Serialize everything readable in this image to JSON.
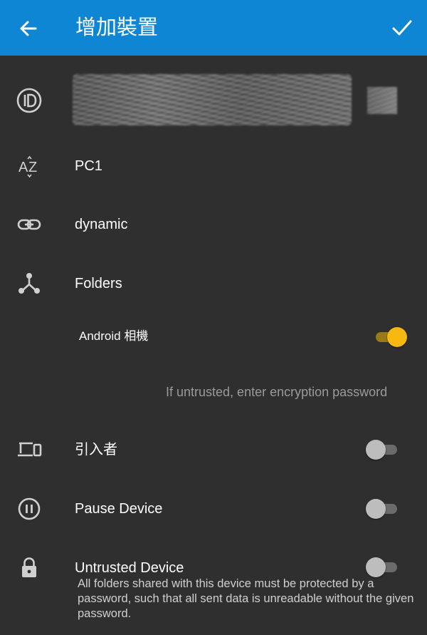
{
  "app_bar": {
    "title": "增加裝置",
    "back_icon": "arrow-left-icon",
    "done_icon": "check-icon"
  },
  "rows": {
    "device_id": {
      "icon": "id-icon",
      "value_state": "redacted (blurred)"
    },
    "name": {
      "icon": "sort-az-icon",
      "value": "PC1"
    },
    "address": {
      "icon": "link-icon",
      "value": "dynamic"
    },
    "folders": {
      "icon": "share-nodes-icon",
      "label": "Folders"
    },
    "folder_item": {
      "label": "Android 相機",
      "enabled": true
    },
    "encryption_hint": "If untrusted, enter encryption password",
    "introducer": {
      "icon": "devices-icon",
      "label": "引入者",
      "enabled": false
    },
    "pause": {
      "icon": "pause-circle-icon",
      "label": "Pause Device",
      "enabled": false
    },
    "untrusted": {
      "icon": "lock-icon",
      "label": "Untrusted Device",
      "description": "All folders shared with this device must be protected by a password, such that all sent data is unreadable without the given password.",
      "enabled": false
    }
  },
  "colors": {
    "app_bar": "#0e86d4",
    "background": "#2f2f2f",
    "switch_on": "#f7b90f",
    "switch_off": "#bdbdbd"
  }
}
